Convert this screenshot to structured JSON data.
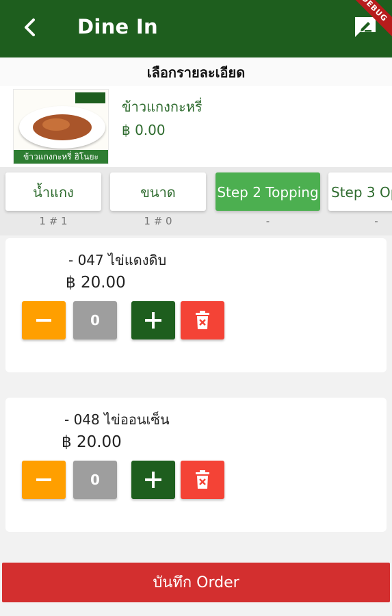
{
  "appbar": {
    "title": "Dine In",
    "debug_banner": "DEBUG",
    "icons": [
      "back-arrow-icon",
      "edit-note-icon"
    ]
  },
  "section_title": "เลือกรายละเอียด",
  "product": {
    "name": "ข้าวแกงกะหรี่",
    "price": "฿ 0.00",
    "image_caption": "ข้าวแกงกะหรี่ ฮิโนยะ"
  },
  "tabs": [
    {
      "label": "น้ำแกง",
      "count": "1 # 1"
    },
    {
      "label": "ขนาด",
      "count": "1 # 0"
    },
    {
      "label": "Step 2 Topping",
      "count": "-"
    },
    {
      "label": "Step 3 Op",
      "count": "-"
    }
  ],
  "items": [
    {
      "name": "- 047 ไข่แดงดิบ",
      "price": "฿ 20.00",
      "qty": "0"
    },
    {
      "name": "- 048 ไข่ออนเซ็น",
      "price": "฿ 20.00",
      "qty": "0"
    }
  ],
  "save_button": "บันทึก Order",
  "colors": {
    "primary": "#1e5e1e",
    "active_tab": "#4caf50",
    "minus": "#ff9f00",
    "qty": "#9e9e9e",
    "delete": "#f44336",
    "save": "#d32f2f"
  }
}
